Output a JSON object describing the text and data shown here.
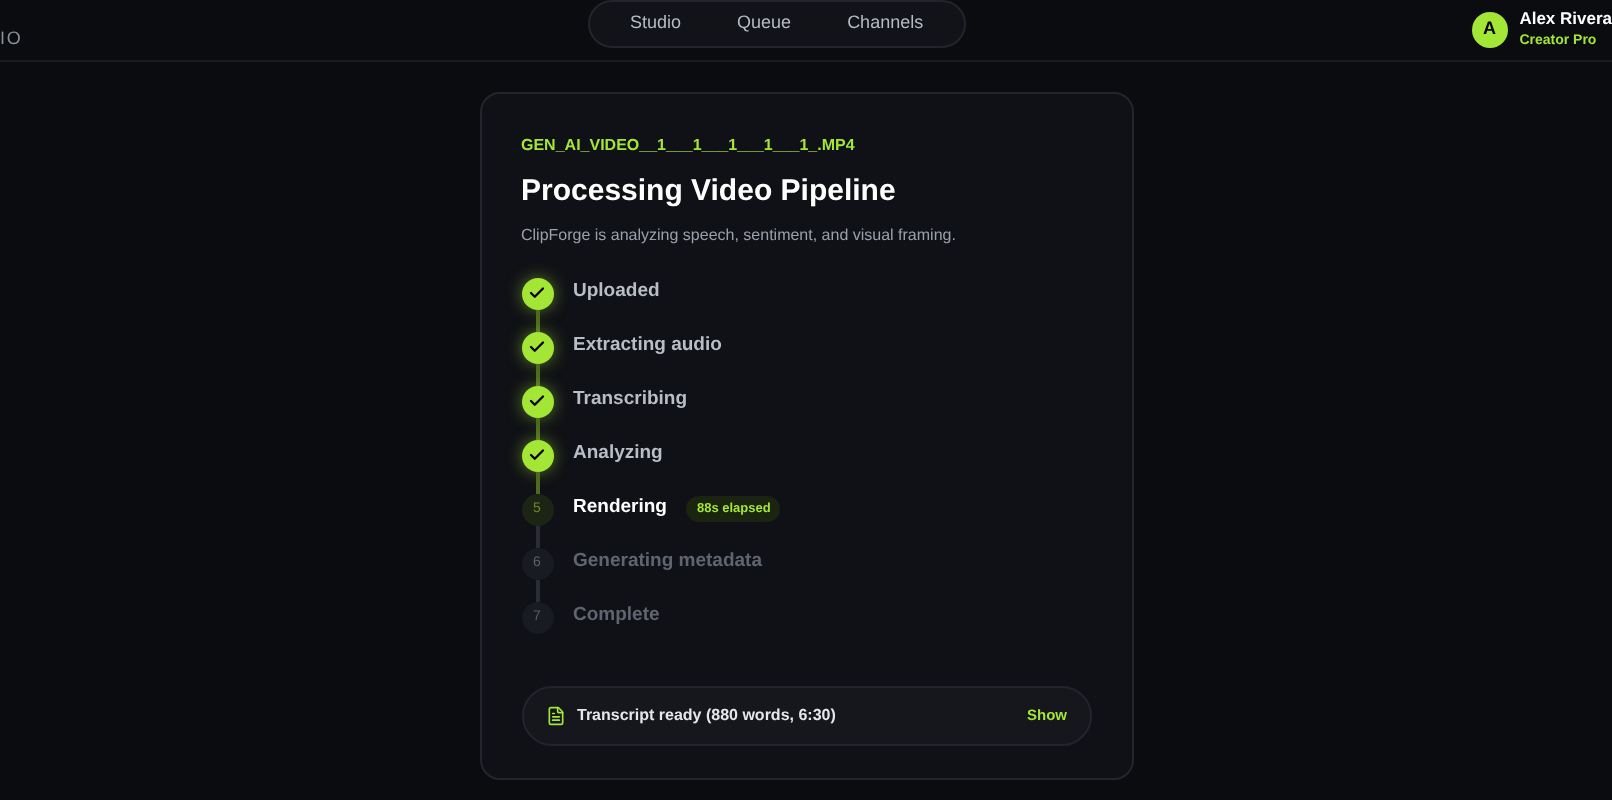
{
  "brand": {
    "text": "IO"
  },
  "nav": [
    {
      "label": "Studio",
      "selected": false
    },
    {
      "label": "Queue",
      "selected": false
    },
    {
      "label": "Channels",
      "selected": false
    }
  ],
  "user": {
    "initial": "A",
    "name": "Alex Rivera",
    "plan": "Creator Pro"
  },
  "card": {
    "filename": "GEN_AI_VIDEO__1___1___1___1___1_.MP4",
    "title": "Processing Video Pipeline",
    "subtitle": "ClipForge is analyzing speech, sentiment, and visual framing.",
    "steps": [
      {
        "kind": "done",
        "label": "Uploaded"
      },
      {
        "kind": "done",
        "label": "Extracting audio"
      },
      {
        "kind": "done",
        "label": "Transcribing"
      },
      {
        "kind": "done",
        "label": "Analyzing"
      },
      {
        "kind": "active",
        "number": "5",
        "label": "Rendering",
        "badge": "88s elapsed"
      },
      {
        "kind": "pending",
        "number": "6",
        "label": "Generating metadata"
      },
      {
        "kind": "pending",
        "number": "7",
        "label": "Complete"
      }
    ],
    "transcript": {
      "text": "Transcript ready (880 words, 6:30)",
      "action": "Show"
    }
  }
}
